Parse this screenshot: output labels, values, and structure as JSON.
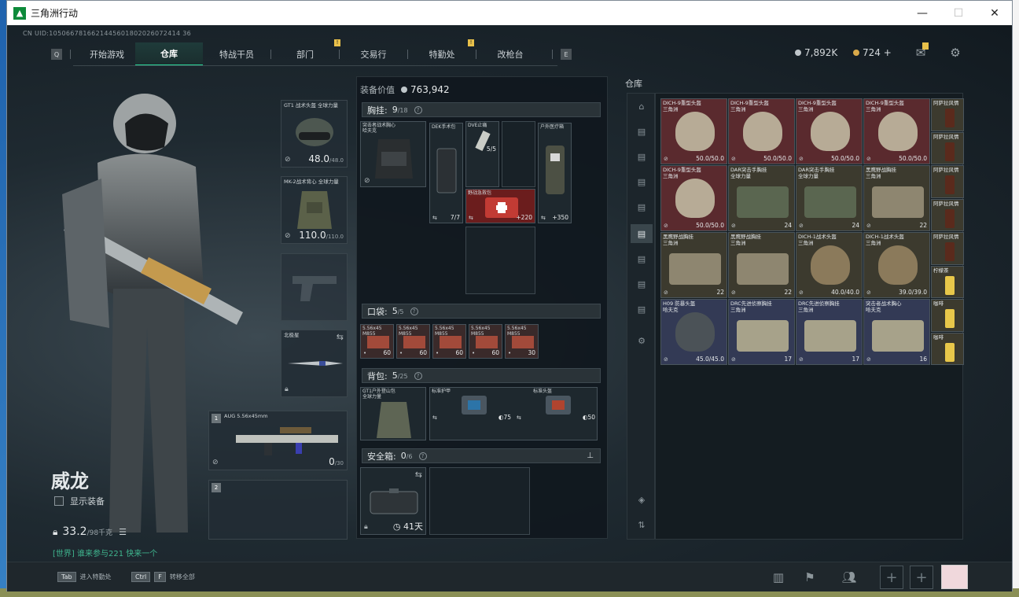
{
  "window": {
    "title": "三角洲行动",
    "min": "—",
    "max": "☐",
    "close": "✕"
  },
  "uid": "CN UID:1050667816621445601802026072414 36",
  "nav": {
    "prev": "Q",
    "next": "E",
    "tabs": [
      {
        "label": "开始游戏"
      },
      {
        "label": "仓库"
      },
      {
        "label": "特战干员"
      },
      {
        "label": "部门",
        "badge": "!"
      },
      {
        "label": "交易行"
      },
      {
        "label": "特勤处",
        "badge": "!"
      },
      {
        "label": "改枪台"
      }
    ]
  },
  "currency": {
    "coins": "7,892K",
    "bonds": "724 +"
  },
  "operator": {
    "name": "威龙",
    "show_equipment": "显示装备",
    "weight": "33.2",
    "weight_max": "/98千克",
    "chat": "[世界] 谁来参与221 快来一个"
  },
  "equip": {
    "helmet": {
      "label": "GT1 战术头盔\n全球力量",
      "value": "48.0",
      "max": "/48.0"
    },
    "armor": {
      "label": "MK-2战术背心\n全球力量",
      "value": "110.0",
      "max": "/110.0"
    },
    "melee": {
      "label": "北极星"
    },
    "gun1": {
      "slot": "1",
      "label": "AUG\n5.56x45mm",
      "value": "0",
      "max": "/30"
    },
    "gun2": {
      "slot": "2"
    }
  },
  "panel": {
    "value_label": "装备价值",
    "value": "763,942",
    "chest": {
      "title": "胸挂:",
      "count": "9",
      "max": "/18",
      "q": "?"
    },
    "chest_items": [
      {
        "label": "突击者战术胸心\n哈夫克"
      },
      {
        "label": "DEK手术包",
        "count": "7/7"
      },
      {
        "label": "DVE止痛",
        "count": "5/5"
      },
      {
        "label": "户外医疗箱",
        "count": "+350"
      },
      {
        "label": "野战急救包",
        "count": "+220"
      }
    ],
    "pocket": {
      "title": "口袋:",
      "count": "5",
      "max": "/5",
      "q": "?"
    },
    "pocket_items": [
      {
        "label": "5.56x45\nM855",
        "count": "60"
      },
      {
        "label": "5.56x45\nM855",
        "count": "60"
      },
      {
        "label": "5.56x45\nM855",
        "count": "60"
      },
      {
        "label": "5.56x45\nM855",
        "count": "60"
      },
      {
        "label": "5.56x45\nM855",
        "count": "30"
      }
    ],
    "backpack": {
      "title": "背包:",
      "count": "5",
      "max": "/25",
      "q": "?"
    },
    "backpack_items": [
      {
        "label": "GT1户外登山包\n全球力量"
      },
      {
        "label": "标准护甲",
        "count": "75"
      },
      {
        "label": "标准头盔",
        "count": "50"
      }
    ],
    "safe": {
      "title": "安全箱:",
      "count": "0",
      "max": "/6",
      "q": "?",
      "days": "41天"
    }
  },
  "warehouse": {
    "label": "仓库",
    "items": [
      {
        "label": "DICH-9重型头盔\n三角洲",
        "count": "50.0/50.0",
        "color": "red"
      },
      {
        "label": "DICH-9重型头盔\n三角洲",
        "count": "50.0/50.0",
        "color": "red"
      },
      {
        "label": "DICH-9重型头盔\n三角洲",
        "count": "50.0/50.0",
        "color": "red"
      },
      {
        "label": "DICH-9重型头盔\n三角洲",
        "count": "50.0/50.0",
        "color": "red"
      },
      {
        "label": "DICH-9重型头盔\n三角洲",
        "count": "50.0/50.0",
        "color": "red"
      },
      {
        "label": "DAR突击手胸挂\n全球力量",
        "count": "24",
        "color": "olive"
      },
      {
        "label": "DAR突击手胸挂\n全球力量",
        "count": "24",
        "color": "olive"
      },
      {
        "label": "黑鹰野战胸挂\n三角洲",
        "count": "22",
        "color": "olive"
      },
      {
        "label": "黑鹰野战胸挂\n三角洲",
        "count": "22",
        "color": "olive"
      },
      {
        "label": "黑鹰野战胸挂\n三角洲",
        "count": "22",
        "color": "olive"
      },
      {
        "label": "DICH-1战术头盔\n三角洲",
        "count": "40.0/40.0",
        "color": "olive"
      },
      {
        "label": "DICH-1战术头盔\n三角洲",
        "count": "39.0/39.0",
        "color": "olive"
      },
      {
        "label": "H09 防暴头盔\n哈夫克",
        "count": "45.0/45.0",
        "color": "blue"
      },
      {
        "label": "DRC先进侦察胸挂\n三角洲",
        "count": "17",
        "color": "blue"
      },
      {
        "label": "DRC先进侦察胸挂\n三角洲",
        "count": "17",
        "color": "blue"
      },
      {
        "label": "突击者战术胸心\n哈夫克",
        "count": "16",
        "color": "blue"
      }
    ],
    "drinks": [
      {
        "label": "阿萨拉风情"
      },
      {
        "label": "阿萨拉风情"
      },
      {
        "label": "阿萨拉风情"
      },
      {
        "label": "阿萨拉风情"
      },
      {
        "label": "阿萨拉风情"
      },
      {
        "label": "柠檬茶"
      },
      {
        "label": "咖啡"
      },
      {
        "label": "咖啡"
      }
    ]
  },
  "bottom": {
    "k1": "Tab",
    "t1": "进入特勤处",
    "k2": "Ctrl",
    "k2b": "F",
    "t2": "转移全部"
  }
}
